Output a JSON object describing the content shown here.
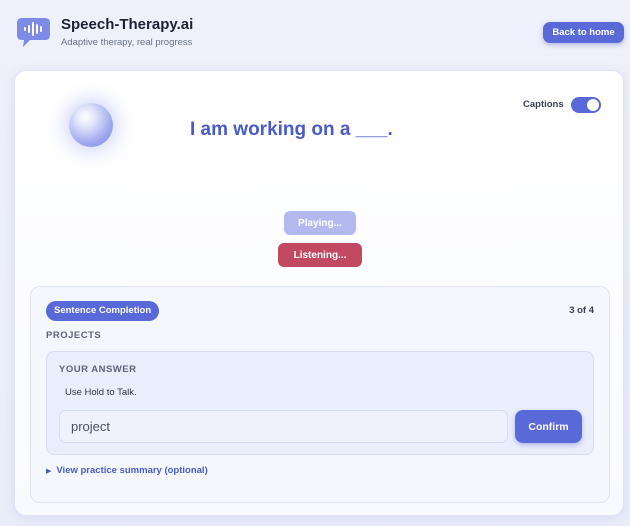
{
  "header": {
    "brand_title": "Speech-Therapy.ai",
    "brand_subtitle": "Adaptive therapy, real progress",
    "back_label": "Back to home",
    "logo_icon": "speech-bubble-waveform-icon"
  },
  "session": {
    "prompt": "I am working on a ___.",
    "captions_label": "Captions",
    "captions_enabled": true,
    "playing_label": "Playing...",
    "listening_label": "Listening..."
  },
  "task": {
    "type_label": "Sentence Completion",
    "progress": "3 of 4",
    "category": "PROJECTS",
    "answer_heading": "YOUR ANSWER",
    "hint": "Use Hold to Talk.",
    "answer_value": "project",
    "confirm_label": "Confirm",
    "summary_link": "View practice summary (optional)",
    "summary_icon": "triangle-right-icon"
  },
  "colors": {
    "accent": "#5a69d8",
    "listening": "#c24962",
    "playing": "#b3b9ee",
    "prompt_text": "#4a5bc7"
  }
}
